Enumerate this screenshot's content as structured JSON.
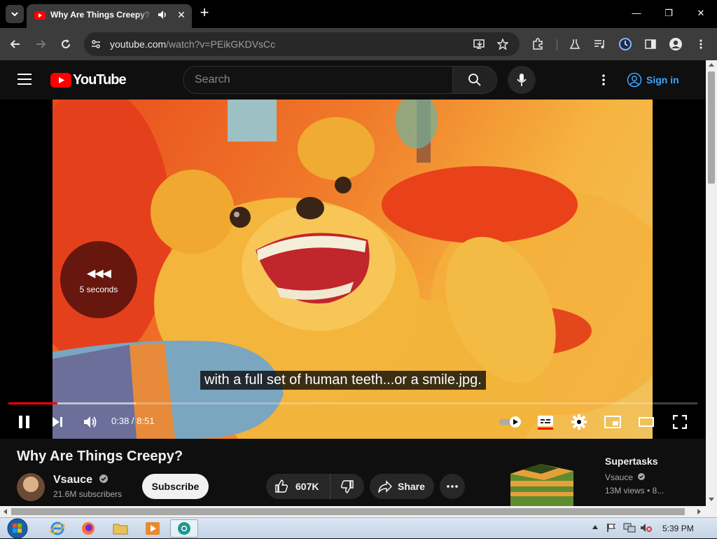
{
  "browser": {
    "tab_title": "Why Are Things Creepy? - YouTube",
    "close_tab": "✕",
    "new_tab": "+",
    "url_host": "youtube.com",
    "url_path": "/watch?v=PEikGKDVsCc",
    "window": {
      "minimize": "—",
      "restore": "❐",
      "close": "✕"
    }
  },
  "youtube": {
    "logo_text": "YouTube",
    "search_placeholder": "Search",
    "sign_in": "Sign in"
  },
  "player": {
    "caption": "with a full set of human teeth...or a smile.jpg.",
    "seek_indicator": "5 seconds",
    "time_current": "0:38",
    "time_total": "8:51",
    "time_display": "0:38 / 8:51",
    "played_fraction": 0.0716,
    "loaded_fraction": 0.185
  },
  "video": {
    "title": "Why Are Things Creepy?",
    "channel": "Vsauce",
    "subscribers": "21.6M subscribers",
    "subscribe": "Subscribe",
    "likes": "607K",
    "share": "Share"
  },
  "recommendation": {
    "title": "Supertasks",
    "channel": "Vsauce",
    "meta": "13M views • 8..."
  },
  "taskbar": {
    "time": "5:39 PM"
  },
  "colors": {
    "youtube_red": "#ff0000",
    "link_blue": "#3ea6ff",
    "bg_dark": "#0f0f0f"
  }
}
